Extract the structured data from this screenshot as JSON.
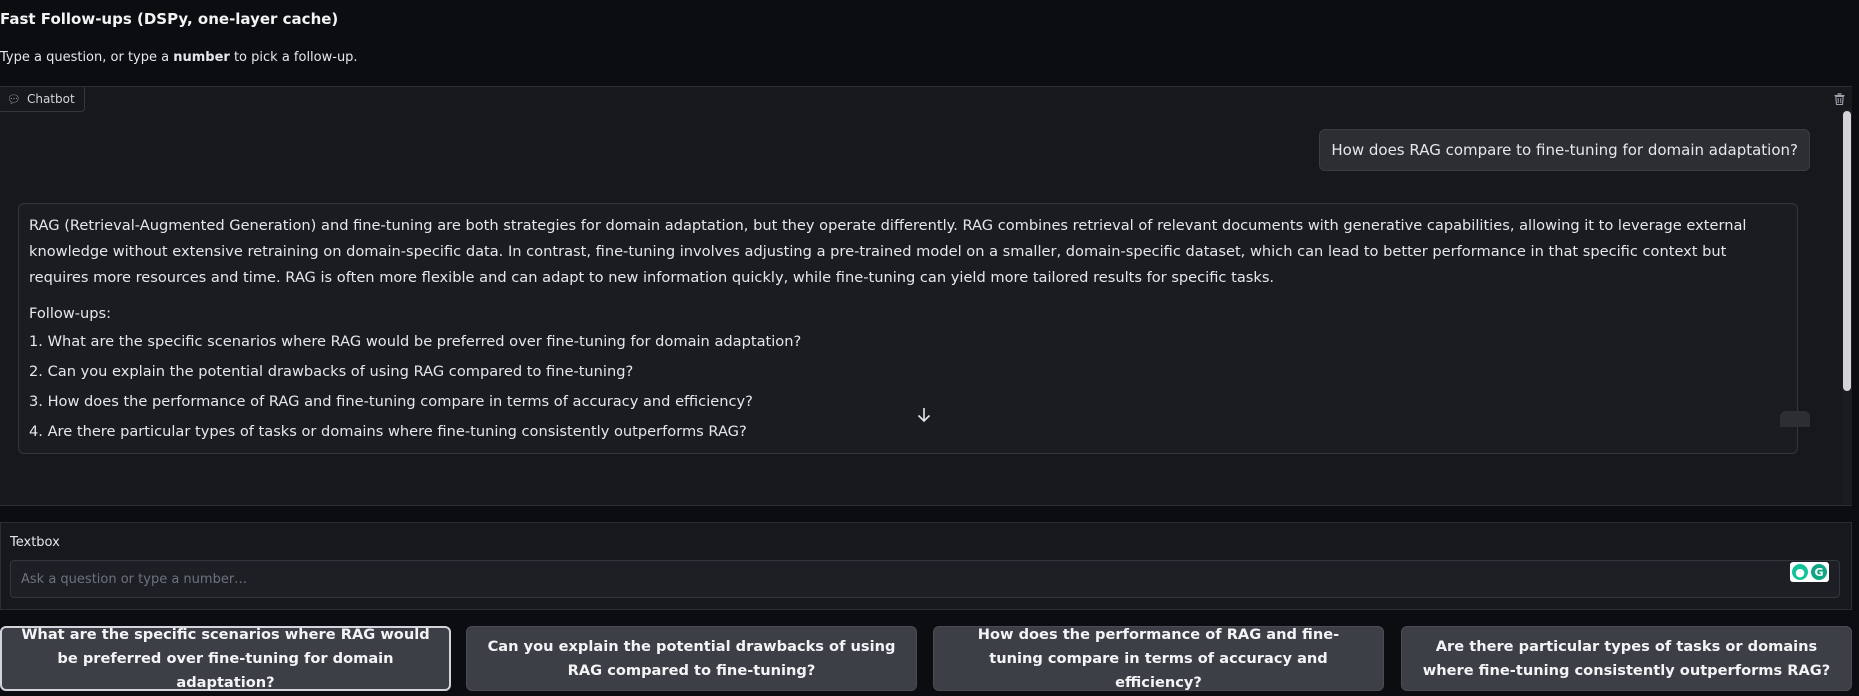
{
  "app": {
    "title": "Fast Follow-ups (DSPy, one-layer cache)",
    "subtitle_prefix": "Type a question, or type a ",
    "subtitle_bold": "number",
    "subtitle_suffix": " to pick a follow-up."
  },
  "chatbot": {
    "label": "Chatbot",
    "label_icon": "chat-bubble-icon",
    "clear_icon": "trash-icon",
    "user_message": "How does RAG compare to fine-tuning for domain adaptation?",
    "bot_message": {
      "answer": "RAG (Retrieval-Augmented Generation) and fine-tuning are both strategies for domain adaptation, but they operate differently. RAG combines retrieval of relevant documents with generative capabilities, allowing it to leverage external knowledge without extensive retraining on domain-specific data. In contrast, fine-tuning involves adjusting a pre-trained model on a smaller, domain-specific dataset, which can lead to better performance in that specific context but requires more resources and time. RAG is often more flexible and can adapt to new information quickly, while fine-tuning can yield more tailored results for specific tasks.",
      "followups_title": "Follow-ups:",
      "followups": [
        "1. What are the specific scenarios where RAG would be preferred over fine-tuning for domain adaptation?",
        "2. Can you explain the potential drawbacks of using RAG compared to fine-tuning?",
        "3. How does the performance of RAG and fine-tuning compare in terms of accuracy and efficiency?",
        "4. Are there particular types of tasks or domains where fine-tuning consistently outperforms RAG?"
      ]
    },
    "scroll_down_icon": "arrow-down-icon"
  },
  "textbox": {
    "label": "Textbox",
    "placeholder": "Ask a question or type a number…",
    "value": ""
  },
  "followup_buttons": [
    {
      "label": "What are the specific scenarios where RAG would be preferred over fine-tuning for domain adaptation?"
    },
    {
      "label": "Can you explain the potential drawbacks of using RAG compared to fine-tuning?"
    },
    {
      "label": "How does the performance of RAG and fine-tuning compare in terms of accuracy and efficiency?"
    },
    {
      "label": "Are there particular types of tasks or domains where fine-tuning consistently outperforms RAG?"
    }
  ]
}
